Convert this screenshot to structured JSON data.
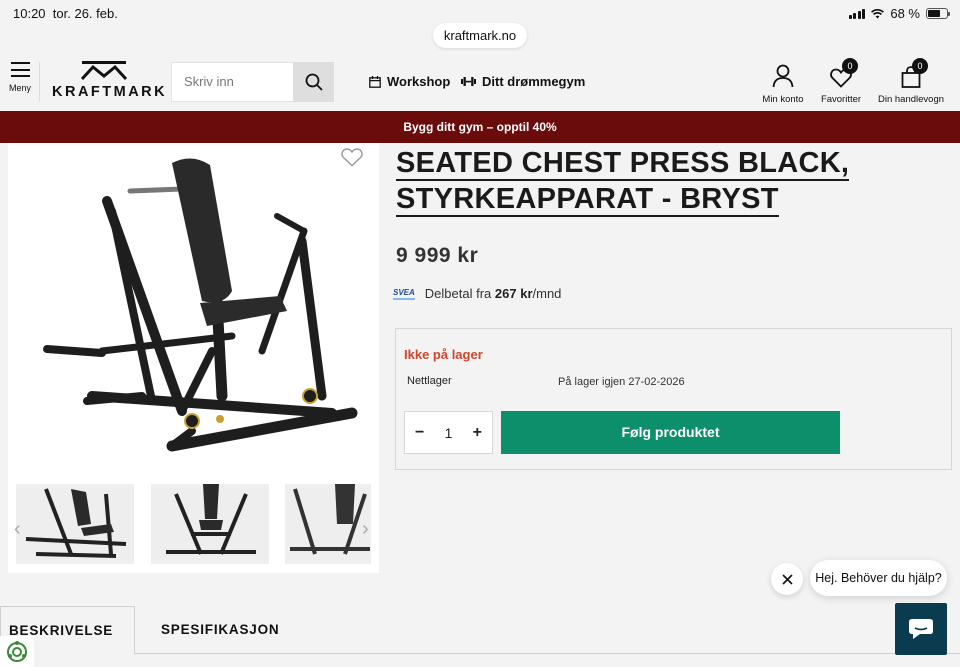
{
  "status_bar": {
    "time": "10:20",
    "date": "tor. 26. feb.",
    "battery": "68 %",
    "battery_level": 0.68
  },
  "browser": {
    "url": "kraftmark.no"
  },
  "header": {
    "menu_label": "Meny",
    "logo_text": "KRAFTMARK",
    "search_placeholder": "Skriv inn søkeord",
    "nav": [
      {
        "label": "Workshop",
        "icon": "calendar-icon"
      },
      {
        "label": "Ditt drømmegym",
        "icon": "dumbbell-icon"
      }
    ],
    "account": {
      "label": "Min konto",
      "icon": "user-icon"
    },
    "favorites": {
      "label": "Favoritter",
      "count": "0",
      "icon": "heart-icon"
    },
    "cart": {
      "label": "Din handlevogn",
      "count": "0",
      "icon": "bag-icon"
    }
  },
  "promo_banner": "Bygg ditt gym – opptil 40%",
  "product": {
    "title_line1": "SEATED CHEST PRESS BLACK,",
    "title_line2": "STYRKEAPPARAT - BRYST",
    "price": "9 999 kr",
    "financing": {
      "provider_logo": "SVEA",
      "prefix": "Delbetal fra",
      "amount": "267 kr",
      "suffix": "/mnd"
    },
    "stock_status": "Ikke på lager",
    "store_label": "Nettlager",
    "restock_text": "På lager igjen 27-02-2026",
    "quantity": "1",
    "follow_button": "Følg produktet"
  },
  "tabs": [
    "BESKRIVELSE",
    "SPESIFIKASJON"
  ],
  "chat": {
    "greeting": "Hej. Behöver du hjälp?"
  },
  "colors": {
    "promo": "#6b0c0c",
    "accent_green": "#0e8f6c",
    "stock_red": "#d1452b",
    "chat": "#0b3b4f"
  }
}
